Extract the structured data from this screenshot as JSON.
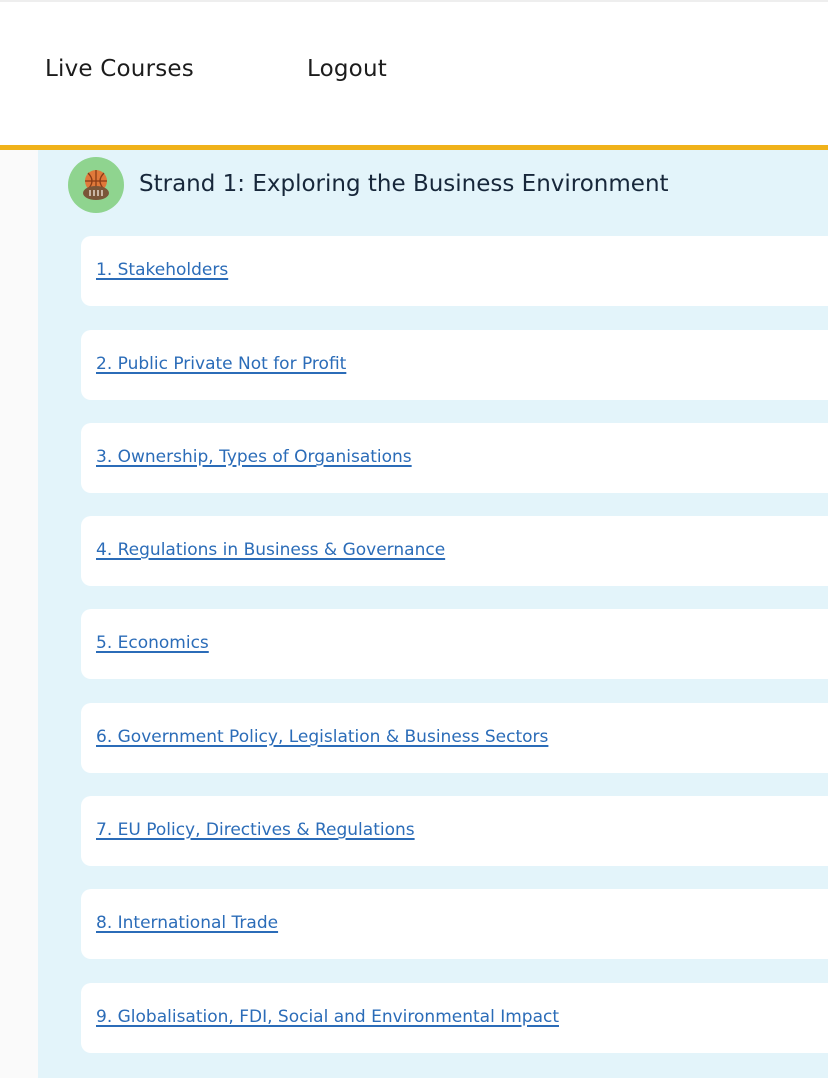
{
  "nav": {
    "live_courses": "Live Courses",
    "logout": "Logout"
  },
  "colors": {
    "accent": "#f0b21a",
    "panel_bg": "#e3f4fa",
    "link": "#2b6cb8",
    "avatar_bg": "#8fd48f"
  },
  "strand": {
    "title": "Strand 1: Exploring the Business Environment",
    "icon": "sports-ball-icon",
    "topics": [
      {
        "label": "1. Stakeholders"
      },
      {
        "label": "2. Public Private Not for Profit"
      },
      {
        "label": "3. Ownership, Types of Organisations"
      },
      {
        "label": "4. Regulations in Business & Governance"
      },
      {
        "label": "5. Economics"
      },
      {
        "label": "6. Government Policy, Legislation & Business Sectors"
      },
      {
        "label": "7. EU Policy, Directives & Regulations"
      },
      {
        "label": "8. International Trade"
      },
      {
        "label": "9. Globalisation, FDI, Social and Environmental Impact"
      }
    ]
  }
}
